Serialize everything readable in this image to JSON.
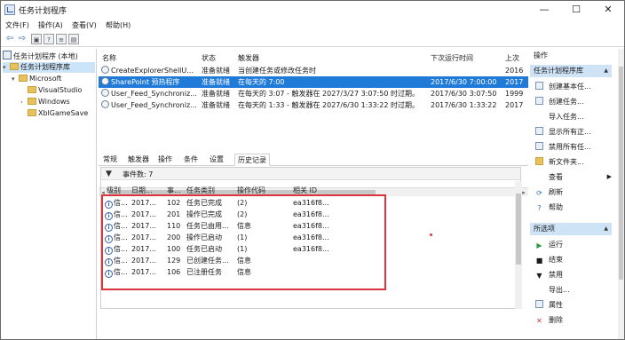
{
  "window": {
    "title": "任务计划程序",
    "min": "—",
    "max": "☐",
    "close": "✕"
  },
  "menu": [
    {
      "label": "文件(F)"
    },
    {
      "label": "操作(A)"
    },
    {
      "label": "查看(V)"
    },
    {
      "label": "帮助(H)"
    }
  ],
  "toolbar_icons": [
    "back-arrow-icon",
    "forward-arrow-icon",
    "folder-up-icon",
    "help-icon",
    "properties-icon",
    "export-icon"
  ],
  "tree": {
    "root": "任务计划程序 (本地)",
    "library": "任务计划程序库",
    "microsoft": "Microsoft",
    "visualstudio": "VisualStudio",
    "windows": "Windows",
    "xbl": "XblGameSave"
  },
  "task_list": {
    "headers": {
      "name": "名称",
      "status": "状态",
      "trigger": "触发器",
      "next_run": "下次运行时间",
      "last_run": "上次"
    },
    "rows": [
      {
        "name": "CreateExplorerShellU...",
        "status": "准备就绪",
        "trigger": "当创建任务或修改任务时",
        "next_run": "",
        "last_run": "2016"
      },
      {
        "name": "SharePoint 预热程序",
        "status": "准备就绪",
        "trigger": "在每天的 7:00",
        "next_run": "2017/6/30 7:00:00",
        "last_run": "2017"
      },
      {
        "name": "User_Feed_Synchroniz...",
        "status": "准备就绪",
        "trigger": "在每天的 3:07 - 触发器在 2027/3/27 3:07:50 时过期。",
        "next_run": "2017/6/30 3:07:50",
        "last_run": "1999"
      },
      {
        "name": "User_Feed_Synchroniz...",
        "status": "准备就绪",
        "trigger": "在每天的 1:33 - 触发器在 2027/6/30 1:33:22 时过期。",
        "next_run": "2017/6/30 1:33:22",
        "last_run": "2017"
      }
    ]
  },
  "tabs": [
    {
      "label": "常规"
    },
    {
      "label": "触发器"
    },
    {
      "label": "操作"
    },
    {
      "label": "条件"
    },
    {
      "label": "设置"
    },
    {
      "label": "历史记录"
    }
  ],
  "history": {
    "count_label": "事件数: 7",
    "headers": {
      "level": "级别",
      "date": "日期...",
      "id": "事...",
      "category": "任务类别",
      "opcode": "操作代码",
      "activity": "相关 ID"
    },
    "rows": [
      {
        "level": "信...",
        "date": "2017...",
        "id": "102",
        "category": "任务已完成",
        "opcode": "(2)",
        "activity": "ea316f8..."
      },
      {
        "level": "信...",
        "date": "2017...",
        "id": "201",
        "category": "操作已完成",
        "opcode": "(2)",
        "activity": "ea316f8..."
      },
      {
        "level": "信...",
        "date": "2017...",
        "id": "110",
        "category": "任务已由用...",
        "opcode": "信息",
        "activity": "ea316f8..."
      },
      {
        "level": "信...",
        "date": "2017...",
        "id": "200",
        "category": "操作已启动",
        "opcode": "(1)",
        "activity": "ea316f8..."
      },
      {
        "level": "信...",
        "date": "2017...",
        "id": "100",
        "category": "任务已启动",
        "opcode": "(1)",
        "activity": "ea316f8..."
      },
      {
        "level": "信...",
        "date": "2017...",
        "id": "129",
        "category": "已创建任务...",
        "opcode": "信息",
        "activity": ""
      },
      {
        "level": "信...",
        "date": "2017...",
        "id": "106",
        "category": "已注册任务",
        "opcode": "信息",
        "activity": ""
      }
    ]
  },
  "actions": {
    "title": "操作",
    "section1": "任务计划程序库",
    "items1": [
      {
        "label": "创建基本任...",
        "icon": "create-basic-task-icon"
      },
      {
        "label": "创建任务...",
        "icon": "create-task-icon"
      },
      {
        "label": "导入任务...",
        "icon": "import-task-icon"
      },
      {
        "label": "显示所有正...",
        "icon": "show-running-icon"
      },
      {
        "label": "禁用所有任...",
        "icon": "disable-all-history-icon"
      },
      {
        "label": "新文件夹...",
        "icon": "new-folder-icon"
      },
      {
        "label": "查看",
        "icon": "view-icon"
      },
      {
        "label": "刷新",
        "icon": "refresh-icon"
      },
      {
        "label": "帮助",
        "icon": "help-icon"
      }
    ],
    "section2": "所选项",
    "items2": [
      {
        "label": "运行",
        "icon": "run-icon"
      },
      {
        "label": "结束",
        "icon": "end-icon"
      },
      {
        "label": "禁用",
        "icon": "disable-icon"
      },
      {
        "label": "导出...",
        "icon": "export-icon"
      },
      {
        "label": "属性",
        "icon": "properties-icon"
      },
      {
        "label": "删除",
        "icon": "delete-icon"
      }
    ]
  },
  "colors": {
    "selection": "#1f7ad8",
    "section_header": "#cfe3f7",
    "annotation": "#d9353b"
  }
}
